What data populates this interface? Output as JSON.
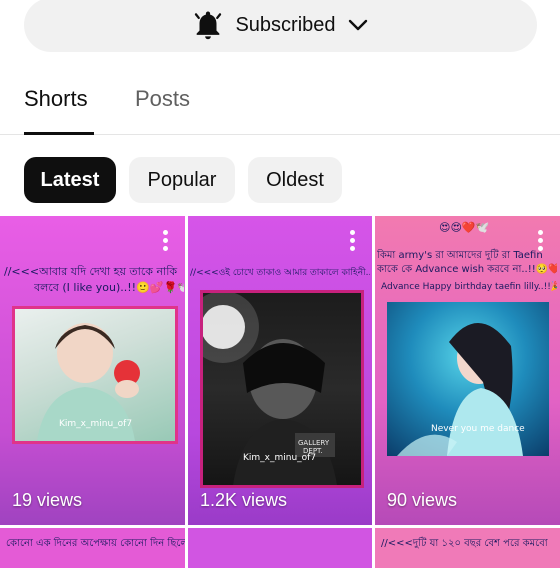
{
  "subscribe": {
    "label": "Subscribed",
    "icon": "bell-icon",
    "dropdown_icon": "chevron-down-icon"
  },
  "tabs": [
    {
      "label": "Shorts",
      "active": true
    },
    {
      "label": "Posts",
      "active": false
    }
  ],
  "filters": [
    {
      "label": "Latest",
      "selected": true
    },
    {
      "label": "Popular",
      "selected": false
    },
    {
      "label": "Oldest",
      "selected": false
    }
  ],
  "shorts": [
    {
      "views": "19 views",
      "caption_line1": "//<<<আবার যদি দেখা হয় তাকে নাকি",
      "caption_line2": "বলবে (I like you)..!!🙂💕🌹🕊️",
      "watermark": "Kim_x_minu_of7",
      "accent": "#e95ee6"
    },
    {
      "views": "1.2K views",
      "caption_line1": "//<<<ওই চোখে তাকাও আমার তাকালে কাহিনী...!!🥺❤️🌹🕊️",
      "caption_line2": "",
      "watermark": "Kim_x_minu_of7",
      "accent": "#d655e8"
    },
    {
      "views": "90 views",
      "caption_line0": "😍😍❤️🕊️",
      "caption_line1": "কিমা army's রা আমাদের দুটি রা Taefin",
      "caption_line2": "কাকে কে Advance wish করবে না..!!🥺❤️",
      "caption_line3": "Advance Happy birthday taefin lilly..!!🎉🕊️",
      "watermark": "Never you me dance",
      "accent": "#f27ab0"
    }
  ],
  "next_row_captions": [
    "কোনো এক দিনের অপেক্ষায় কোনো দিন ছিলো...!!🌼",
    "",
    "//<<<দুটি যা ১২০ বছর বেশ পরে কমবো"
  ]
}
